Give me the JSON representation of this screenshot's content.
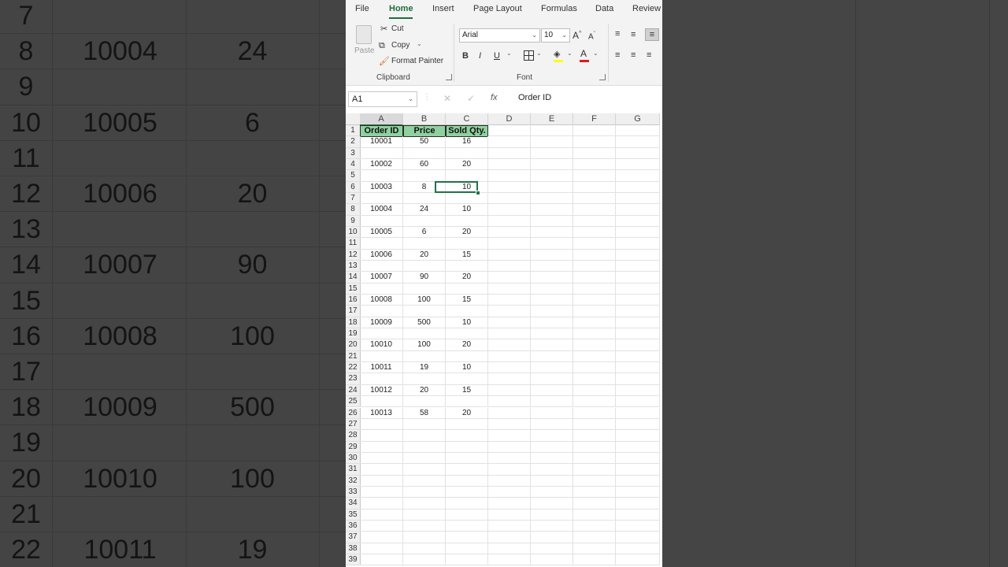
{
  "ribbon": {
    "tabs": [
      "File",
      "Home",
      "Insert",
      "Page Layout",
      "Formulas",
      "Data",
      "Review"
    ],
    "active_tab": "Home",
    "clipboard": {
      "paste": "Paste",
      "cut": "Cut",
      "copy": "Copy",
      "format_painter": "Format Painter",
      "group_label": "Clipboard"
    },
    "font": {
      "name": "Arial",
      "size": "10",
      "group_label": "Font",
      "bold": "B",
      "italic": "I",
      "underline": "U"
    }
  },
  "formula_bar": {
    "name_box": "A1",
    "content": "Order ID",
    "fx": "fx"
  },
  "columns": [
    "A",
    "B",
    "C",
    "D",
    "E",
    "F",
    "G"
  ],
  "header": {
    "order_id": "Order ID",
    "price": "Price",
    "sold_qty": "Sold Qty."
  },
  "rows": [
    {
      "r": "2",
      "a": "10001",
      "b": "50",
      "c": "16"
    },
    {
      "r": "3",
      "a": "",
      "b": "",
      "c": ""
    },
    {
      "r": "4",
      "a": "10002",
      "b": "60",
      "c": "20"
    },
    {
      "r": "5",
      "a": "",
      "b": "",
      "c": ""
    },
    {
      "r": "6",
      "a": "10003",
      "b": "8",
      "c": "10"
    },
    {
      "r": "7",
      "a": "",
      "b": "",
      "c": ""
    },
    {
      "r": "8",
      "a": "10004",
      "b": "24",
      "c": "10"
    },
    {
      "r": "9",
      "a": "",
      "b": "",
      "c": ""
    },
    {
      "r": "10",
      "a": "10005",
      "b": "6",
      "c": "20"
    },
    {
      "r": "11",
      "a": "",
      "b": "",
      "c": ""
    },
    {
      "r": "12",
      "a": "10006",
      "b": "20",
      "c": "15"
    },
    {
      "r": "13",
      "a": "",
      "b": "",
      "c": ""
    },
    {
      "r": "14",
      "a": "10007",
      "b": "90",
      "c": "20"
    },
    {
      "r": "15",
      "a": "",
      "b": "",
      "c": ""
    },
    {
      "r": "16",
      "a": "10008",
      "b": "100",
      "c": "15"
    },
    {
      "r": "17",
      "a": "",
      "b": "",
      "c": ""
    },
    {
      "r": "18",
      "a": "10009",
      "b": "500",
      "c": "10"
    },
    {
      "r": "19",
      "a": "",
      "b": "",
      "c": ""
    },
    {
      "r": "20",
      "a": "10010",
      "b": "100",
      "c": "20"
    },
    {
      "r": "21",
      "a": "",
      "b": "",
      "c": ""
    },
    {
      "r": "22",
      "a": "10011",
      "b": "19",
      "c": "10"
    },
    {
      "r": "23",
      "a": "",
      "b": "",
      "c": ""
    },
    {
      "r": "24",
      "a": "10012",
      "b": "20",
      "c": "15"
    },
    {
      "r": "25",
      "a": "",
      "b": "",
      "c": ""
    },
    {
      "r": "26",
      "a": "10013",
      "b": "58",
      "c": "20"
    },
    {
      "r": "27",
      "a": "",
      "b": "",
      "c": ""
    },
    {
      "r": "28",
      "a": "",
      "b": "",
      "c": ""
    },
    {
      "r": "29",
      "a": "",
      "b": "",
      "c": ""
    },
    {
      "r": "30",
      "a": "",
      "b": "",
      "c": ""
    },
    {
      "r": "31",
      "a": "",
      "b": "",
      "c": ""
    },
    {
      "r": "32",
      "a": "",
      "b": "",
      "c": ""
    },
    {
      "r": "33",
      "a": "",
      "b": "",
      "c": ""
    },
    {
      "r": "34",
      "a": "",
      "b": "",
      "c": ""
    },
    {
      "r": "35",
      "a": "",
      "b": "",
      "c": ""
    },
    {
      "r": "36",
      "a": "",
      "b": "",
      "c": ""
    },
    {
      "r": "37",
      "a": "",
      "b": "",
      "c": ""
    },
    {
      "r": "38",
      "a": "",
      "b": "",
      "c": ""
    },
    {
      "r": "39",
      "a": "",
      "b": "",
      "c": ""
    }
  ],
  "selected_cell": "C6",
  "background_zoom": {
    "rows": [
      {
        "r": "7",
        "a": "",
        "b": ""
      },
      {
        "r": "8",
        "a": "10004",
        "b": "24"
      },
      {
        "r": "9",
        "a": "",
        "b": ""
      },
      {
        "r": "10",
        "a": "10005",
        "b": "6"
      },
      {
        "r": "11",
        "a": "",
        "b": ""
      },
      {
        "r": "12",
        "a": "10006",
        "b": "20"
      },
      {
        "r": "13",
        "a": "",
        "b": ""
      },
      {
        "r": "14",
        "a": "10007",
        "b": "90"
      },
      {
        "r": "15",
        "a": "",
        "b": ""
      },
      {
        "r": "16",
        "a": "10008",
        "b": "100"
      },
      {
        "r": "17",
        "a": "",
        "b": ""
      },
      {
        "r": "18",
        "a": "10009",
        "b": "500"
      },
      {
        "r": "19",
        "a": "",
        "b": ""
      },
      {
        "r": "20",
        "a": "10010",
        "b": "100"
      },
      {
        "r": "21",
        "a": "",
        "b": ""
      },
      {
        "r": "22",
        "a": "10011",
        "b": "19"
      }
    ]
  },
  "colors": {
    "accent": "#217346",
    "header_fill": "#8fd19e"
  }
}
